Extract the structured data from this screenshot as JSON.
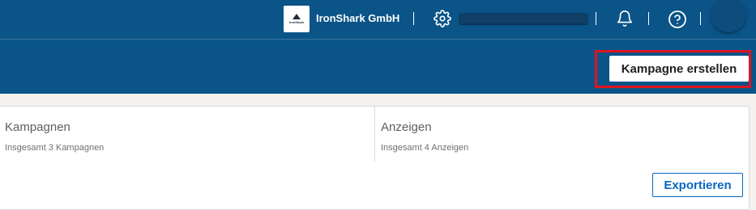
{
  "header": {
    "company_name": "IronShark GmbH",
    "logo_text": "IronShark",
    "icons": [
      "gear-icon",
      "bell-icon",
      "help-icon"
    ],
    "background_color": "#0a5488"
  },
  "toolbar": {
    "create_campaign_label": "Kampagne erstellen",
    "highlight_color": "#e0141e"
  },
  "stats": [
    {
      "title": "Kampagnen",
      "subtitle": "Insgesamt 3 Kampagnen"
    },
    {
      "title": "Anzeigen",
      "subtitle": "Insgesamt 4 Anzeigen"
    }
  ],
  "actions": {
    "export_label": "Exportieren",
    "accent_color": "#0a66c2"
  }
}
